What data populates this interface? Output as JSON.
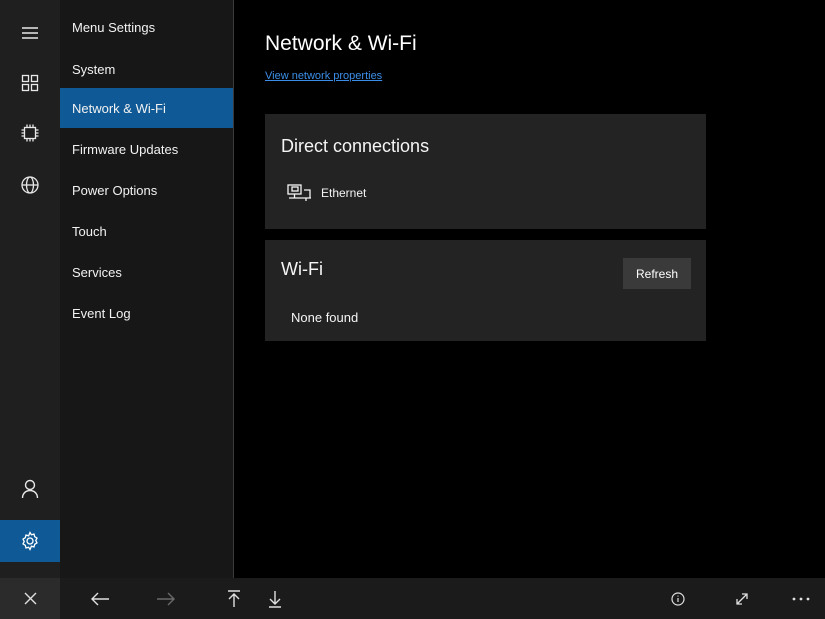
{
  "sidebar": {
    "items": [
      {
        "label": "Menu Settings"
      },
      {
        "label": "System"
      },
      {
        "label": "Network & Wi-Fi"
      },
      {
        "label": "Firmware Updates"
      },
      {
        "label": "Power Options"
      },
      {
        "label": "Touch"
      },
      {
        "label": "Services"
      },
      {
        "label": "Event Log"
      }
    ],
    "selected": "Network & Wi-Fi"
  },
  "rail": {
    "icons": [
      "hamburger-icon",
      "grid-icon",
      "chip-icon",
      "globe-icon",
      "person-icon",
      "gear-icon"
    ],
    "active": "gear-icon"
  },
  "main": {
    "title": "Network & Wi-Fi",
    "link": "View network properties",
    "direct": {
      "title": "Direct connections",
      "connection": "Ethernet"
    },
    "wifi": {
      "title": "Wi-Fi",
      "refresh_label": "Refresh",
      "status": "None found"
    }
  },
  "bottom_bar": {
    "icons": [
      "close-icon",
      "back-arrow-icon",
      "forward-arrow-icon",
      "scroll-top-icon",
      "scroll-bottom-icon",
      "info-icon",
      "expand-icon",
      "more-icon"
    ]
  },
  "colors": {
    "accent": "#0f5a96",
    "link": "#3b8ee8",
    "card": "#232323"
  }
}
